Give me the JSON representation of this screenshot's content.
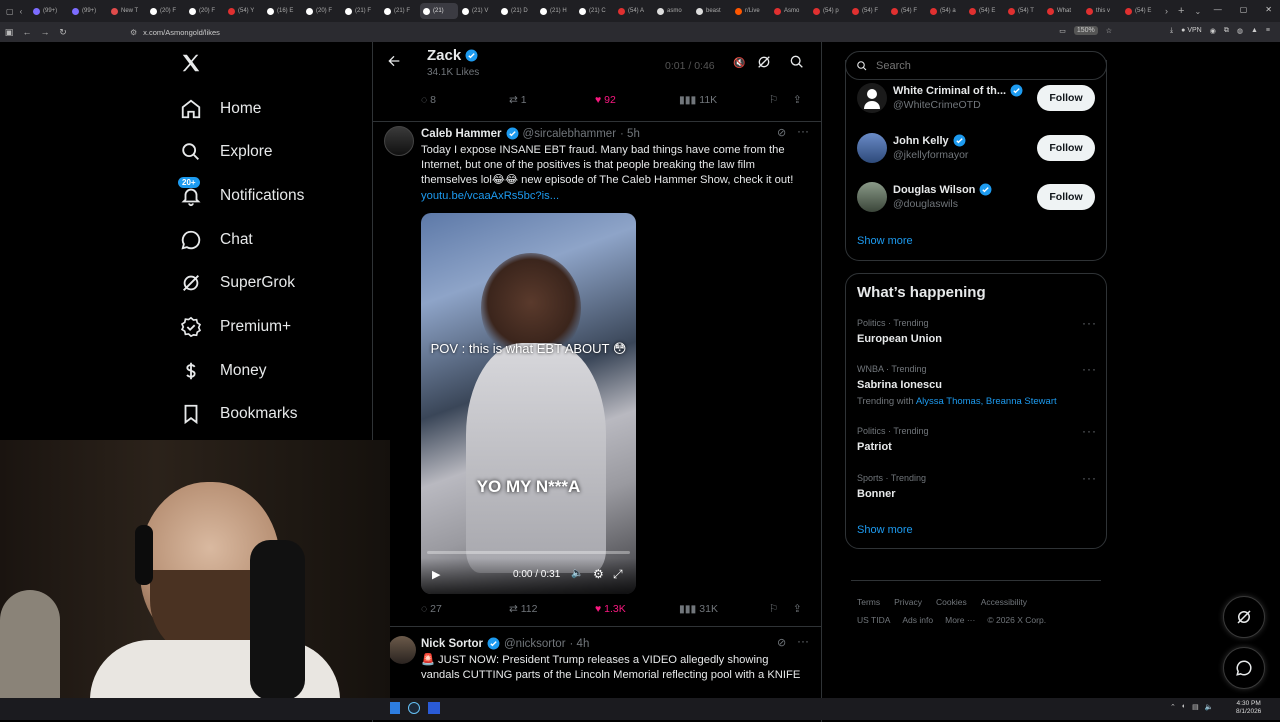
{
  "browser": {
    "tabs": [
      {
        "label": "(99+)",
        "color": "#7c6cff"
      },
      {
        "label": "(99+)",
        "color": "#7c6cff"
      },
      {
        "label": "New T",
        "color": "#e04b4b"
      },
      {
        "label": "(20) F",
        "color": "#ffffff"
      },
      {
        "label": "(20) F",
        "color": "#ffffff"
      },
      {
        "label": "(54) Y",
        "color": "#e03030"
      },
      {
        "label": "(16) E",
        "color": "#ffffff"
      },
      {
        "label": "(20) F",
        "color": "#ffffff"
      },
      {
        "label": "(21) F",
        "color": "#ffffff"
      },
      {
        "label": "(21) F",
        "color": "#ffffff"
      },
      {
        "label": "(21)",
        "color": "#ffffff"
      },
      {
        "label": "(21) V",
        "color": "#ffffff"
      },
      {
        "label": "(21) D",
        "color": "#ffffff"
      },
      {
        "label": "(21) H",
        "color": "#ffffff"
      },
      {
        "label": "(21) C",
        "color": "#ffffff"
      },
      {
        "label": "(54) A",
        "color": "#e03030"
      },
      {
        "label": "asmo",
        "color": "#dddddd"
      },
      {
        "label": "beast",
        "color": "#dddddd"
      },
      {
        "label": "r/Live",
        "color": "#ff5700"
      },
      {
        "label": "Asmo",
        "color": "#e03030"
      },
      {
        "label": "(54) p",
        "color": "#e03030"
      },
      {
        "label": "(54) F",
        "color": "#e03030"
      },
      {
        "label": "(54) F",
        "color": "#e03030"
      },
      {
        "label": "(54) a",
        "color": "#e03030"
      },
      {
        "label": "(54) E",
        "color": "#e03030"
      },
      {
        "label": "(54) T",
        "color": "#e03030"
      },
      {
        "label": "What",
        "color": "#e03030"
      },
      {
        "label": "this v",
        "color": "#e03030"
      },
      {
        "label": "(54) E",
        "color": "#e03030"
      }
    ],
    "active_tab_index": 10,
    "url": "x.com/Asmongold/likes",
    "zoom": "150%",
    "vpn_label": "VPN"
  },
  "nav": {
    "items": [
      {
        "label": "Home",
        "icon": "home-icon"
      },
      {
        "label": "Explore",
        "icon": "search-icon"
      },
      {
        "label": "Notifications",
        "icon": "bell-icon",
        "badge": "20+"
      },
      {
        "label": "Chat",
        "icon": "chat-icon"
      },
      {
        "label": "SuperGrok",
        "icon": "grok-icon"
      },
      {
        "label": "Premium+",
        "icon": "premium-icon"
      },
      {
        "label": "Money",
        "icon": "money-icon"
      },
      {
        "label": "Bookmarks",
        "icon": "bookmark-icon"
      }
    ]
  },
  "profile_header": {
    "name": "Zack",
    "likes_count": "34.1K Likes",
    "video_time": "0:01 / 0:46"
  },
  "prev_tweet_actions": {
    "replies": "8",
    "reposts": "1",
    "likes": "92",
    "views": "11K"
  },
  "tweet": {
    "author": "Caleb Hammer",
    "handle": "@sircalebhammer",
    "time": "· 5h",
    "text_line1": "Today I expose INSANE EBT fraud. Many bad things have come from the",
    "text_line2": "Internet, but one of the positives is that people breaking the law film",
    "text_line3": "themselves lol😂😂 new episode of The Caleb Hammer Show, check it out!",
    "link": "youtu.be/vcaaAxRs5bc?is...",
    "video_caption_top": "POV : this is what EBT ABOUT 😳",
    "video_caption_bottom": "YO MY N***A",
    "video_time": "0:00 / 0:31",
    "video_progress": 0.0,
    "actions": {
      "replies": "27",
      "reposts": "112",
      "likes": "1.3K",
      "views": "31K"
    }
  },
  "next_tweet": {
    "author": "Nick Sortor",
    "handle": "@nicksortor",
    "time": "· 4h",
    "text_line1": "🚨 JUST NOW: President Trump releases a VIDEO allegedly showing",
    "text_line2": "vandals CUTTING parts of the Lincoln Memorial reflecting pool with a KNIFE"
  },
  "search": {
    "placeholder": "Search"
  },
  "who_to_follow": {
    "accounts": [
      {
        "name": "White Criminal of th...",
        "handle": "@WhiteCrimeOTD",
        "follow": "Follow"
      },
      {
        "name": "John Kelly",
        "handle": "@jkellyformayor",
        "follow": "Follow"
      },
      {
        "name": "Douglas Wilson",
        "handle": "@douglaswils",
        "follow": "Follow"
      }
    ],
    "show_more": "Show more"
  },
  "trends": {
    "title": "What’s happening",
    "items": [
      {
        "context": "Politics · Trending",
        "name": "European Union"
      },
      {
        "context": "WNBA · Trending",
        "name": "Sabrina Ionescu",
        "trending_with_label": "Trending with",
        "trending_with": "Alyssa Thomas, Breanna Stewart"
      },
      {
        "context": "Politics · Trending",
        "name": "Patriot"
      },
      {
        "context": "Sports · Trending",
        "name": "Bonner"
      }
    ],
    "show_more": "Show more"
  },
  "footer": {
    "line1": [
      "Terms",
      "Privacy",
      "Cookies",
      "Accessibility"
    ],
    "line2": [
      "US TIDA",
      "Ads info",
      "More ···",
      "© 2026 X Corp."
    ]
  },
  "taskbar": {
    "time": "4:30 PM",
    "date": "8/1/2026"
  },
  "colors": {
    "accent": "#1d9bf0",
    "like": "#f91880",
    "background": "#000000"
  }
}
